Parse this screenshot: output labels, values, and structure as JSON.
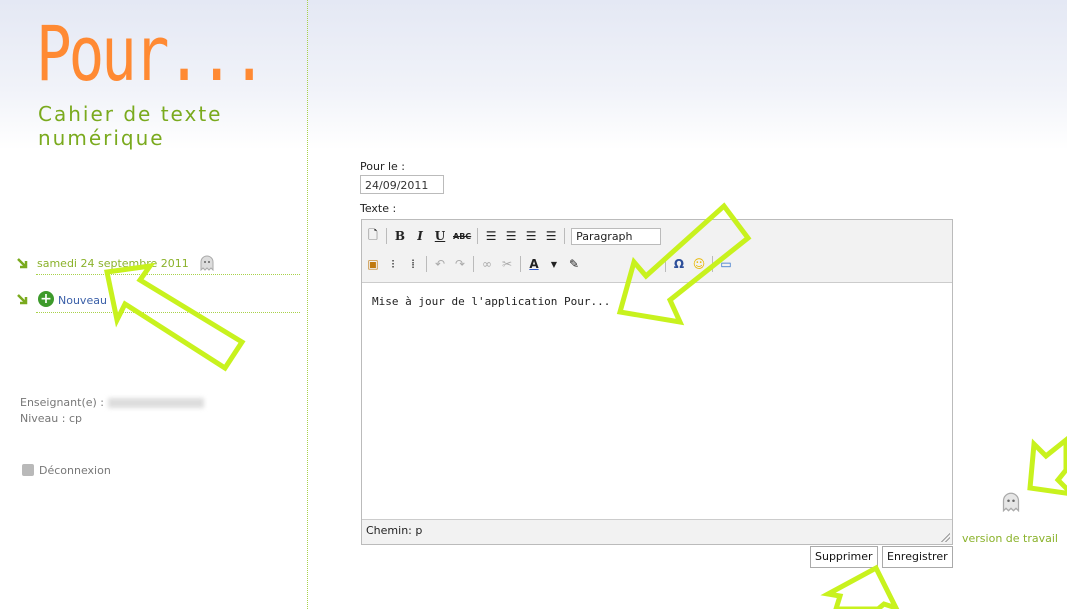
{
  "brand": {
    "logo": "Pour...",
    "tagline": "Cahier de texte numérique"
  },
  "sidebar": {
    "entries": [
      {
        "label": "samedi 24 septembre 2011"
      },
      {
        "label": "Nouveau"
      }
    ],
    "teacher_label": "Enseignant(e) :",
    "level_label": "Niveau : cp",
    "logout_label": "Déconnexion"
  },
  "form": {
    "date_label": "Pour le :",
    "date_value": "24/09/2011",
    "text_label": "Texte :",
    "format_select": "Paragraph",
    "content": "Mise à jour de l'application Pour...",
    "path": "Chemin: p"
  },
  "actions": {
    "delete_label": "Supprimer",
    "save_label": "Enregistrer"
  },
  "footer": {
    "version_label": "version de travail"
  },
  "colors": {
    "accent_green": "#8ab22a",
    "logo_orange": "#ff8a33",
    "annotation_arrow": "#c8f21e"
  }
}
